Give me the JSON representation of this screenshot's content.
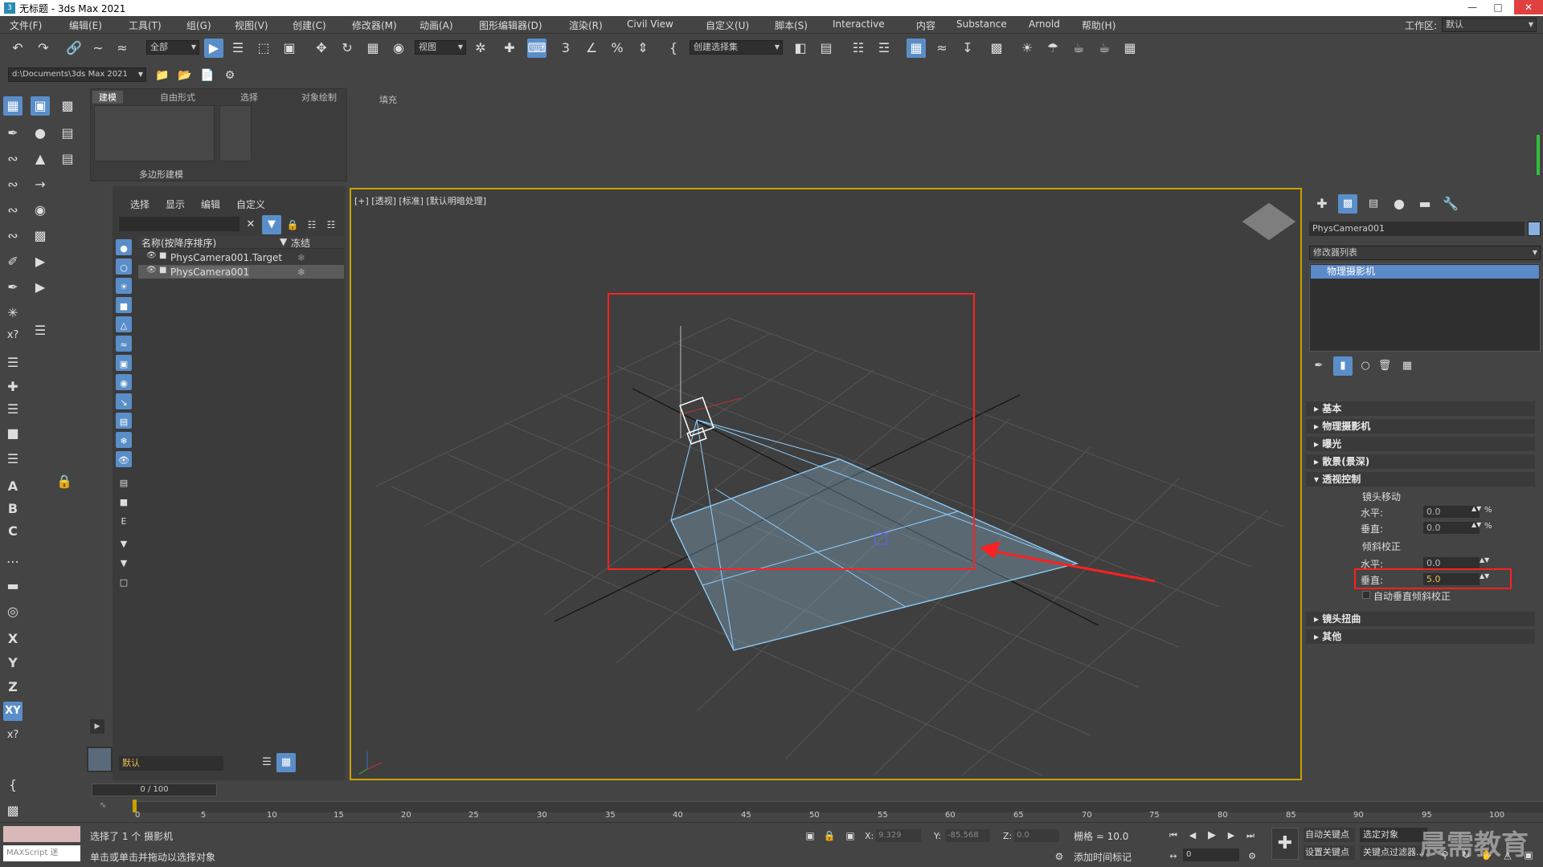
{
  "window": {
    "title": "无标题 - 3ds Max 2021",
    "logo": "3"
  },
  "menu": [
    "文件(F)",
    "编辑(E)",
    "工具(T)",
    "组(G)",
    "视图(V)",
    "创建(C)",
    "修改器(M)",
    "动画(A)",
    "图形编辑器(D)",
    "渲染(R)",
    "Civil View",
    "自定义(U)",
    "脚本(S)",
    "Interactive",
    "内容",
    "Substance",
    "Arnold",
    "帮助(H)"
  ],
  "workspace": {
    "label": "工作区:",
    "value": "默认"
  },
  "toolbar": {
    "filter": "全部",
    "ref_coord": "视图",
    "selection_set": "创建选择集"
  },
  "project_path": "d:\\Documents\\3ds Max 2021",
  "ribbon": {
    "tabs": [
      "建模",
      "自由形式",
      "选择",
      "对象绘制",
      "填充"
    ],
    "footer": "多边形建模"
  },
  "scene_explorer": {
    "tabs": [
      "选择",
      "显示",
      "编辑",
      "自定义"
    ],
    "col_name": "名称(按降序排序)",
    "col_freeze": "冻结",
    "items": [
      "PhysCamera001.Target",
      "PhysCamera001"
    ],
    "layer": "默认"
  },
  "viewport": {
    "label": "[+] [透视] [标准] [默认明暗处理]"
  },
  "cmdpanel": {
    "object_name": "PhysCamera001",
    "modifier_list": "修改器列表",
    "stack_item": "物理摄影机",
    "rollouts_top": [
      "基本",
      "物理摄影机",
      "曝光",
      "散景(景深)"
    ],
    "persp_title": "透视控制",
    "lens_shift": "镜头移动",
    "tilt": "倾斜校正",
    "h_label": "水平:",
    "v_label": "垂直:",
    "lens_h": "0.0",
    "lens_v": "0.0",
    "tilt_h": "0.0",
    "tilt_v": "5.0",
    "pct": "%",
    "auto_tilt": "自动垂直倾斜校正",
    "rollouts_bottom": [
      "镜头扭曲",
      "其他"
    ]
  },
  "timeline": {
    "frame": "0 / 100",
    "ticks": [
      "0",
      "5",
      "10",
      "15",
      "20",
      "25",
      "30",
      "35",
      "40",
      "45",
      "50",
      "55",
      "60",
      "65",
      "70",
      "75",
      "80",
      "85",
      "90",
      "95",
      "100"
    ]
  },
  "status": {
    "maxscript": "MAXScript 迷",
    "line1": "选择了 1 个 摄影机",
    "line2": "单击或单击并拖动以选择对象",
    "x_label": "X:",
    "x": "9.329",
    "y_label": "Y:",
    "y": "-85.568",
    "z_label": "Z:",
    "z": "0.0",
    "grid": "栅格 = 10.0",
    "add_time_tag": "添加时间标记",
    "autokey": "自动关键点",
    "setkey": "设置关键点",
    "selected": "选定对象",
    "keyfilter": "关键点过滤器...",
    "frame_field": "0"
  },
  "watermark": "晨需教育"
}
